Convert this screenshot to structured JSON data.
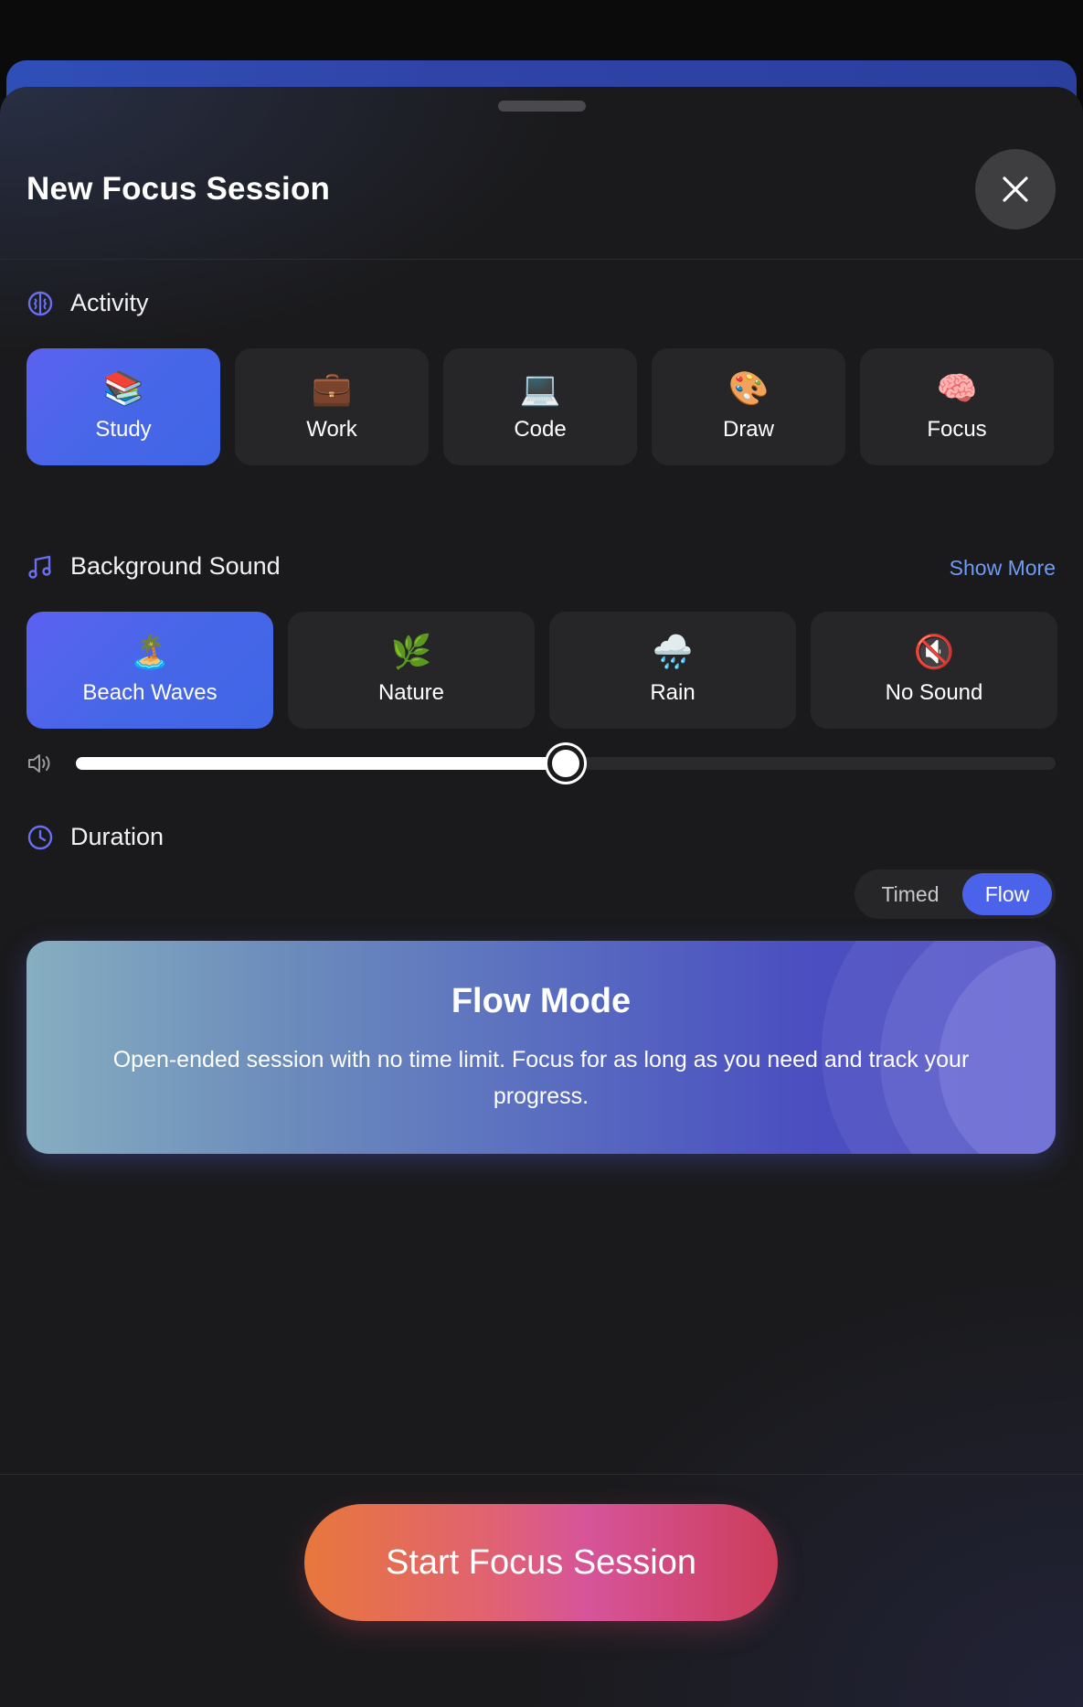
{
  "header": {
    "title": "New Focus Session",
    "close_icon": "close-icon"
  },
  "activity": {
    "label": "Activity",
    "icon": "brain-outline-icon",
    "items": [
      {
        "emoji": "📚",
        "label": "Study",
        "selected": true
      },
      {
        "emoji": "💼",
        "label": "Work",
        "selected": false
      },
      {
        "emoji": "💻",
        "label": "Code",
        "selected": false
      },
      {
        "emoji": "🎨",
        "label": "Draw",
        "selected": false
      },
      {
        "emoji": "🧠",
        "label": "Focus",
        "selected": false
      }
    ]
  },
  "sound": {
    "label": "Background Sound",
    "icon": "music-note-icon",
    "show_more": "Show More",
    "items": [
      {
        "emoji": "🏝️",
        "label": "Beach Waves",
        "selected": true
      },
      {
        "emoji": "🌿",
        "label": "Nature",
        "selected": false
      },
      {
        "emoji": "🌧️",
        "label": "Rain",
        "selected": false
      },
      {
        "emoji": "🔇",
        "label": "No Sound",
        "selected": false
      }
    ],
    "volume_percent": 50
  },
  "duration": {
    "label": "Duration",
    "icon": "clock-icon",
    "modes": [
      "Timed",
      "Flow"
    ],
    "selected_mode": "Flow",
    "card": {
      "title": "Flow Mode",
      "description": "Open-ended session with no time limit. Focus for as long as you need and track your progress."
    }
  },
  "footer": {
    "start_label": "Start Focus Session"
  },
  "colors": {
    "accent_blue": "#4a63ea",
    "link_blue": "#6f9bf5",
    "start_gradient": [
      "#e8773c",
      "#d6549a",
      "#cc3d5a"
    ]
  }
}
